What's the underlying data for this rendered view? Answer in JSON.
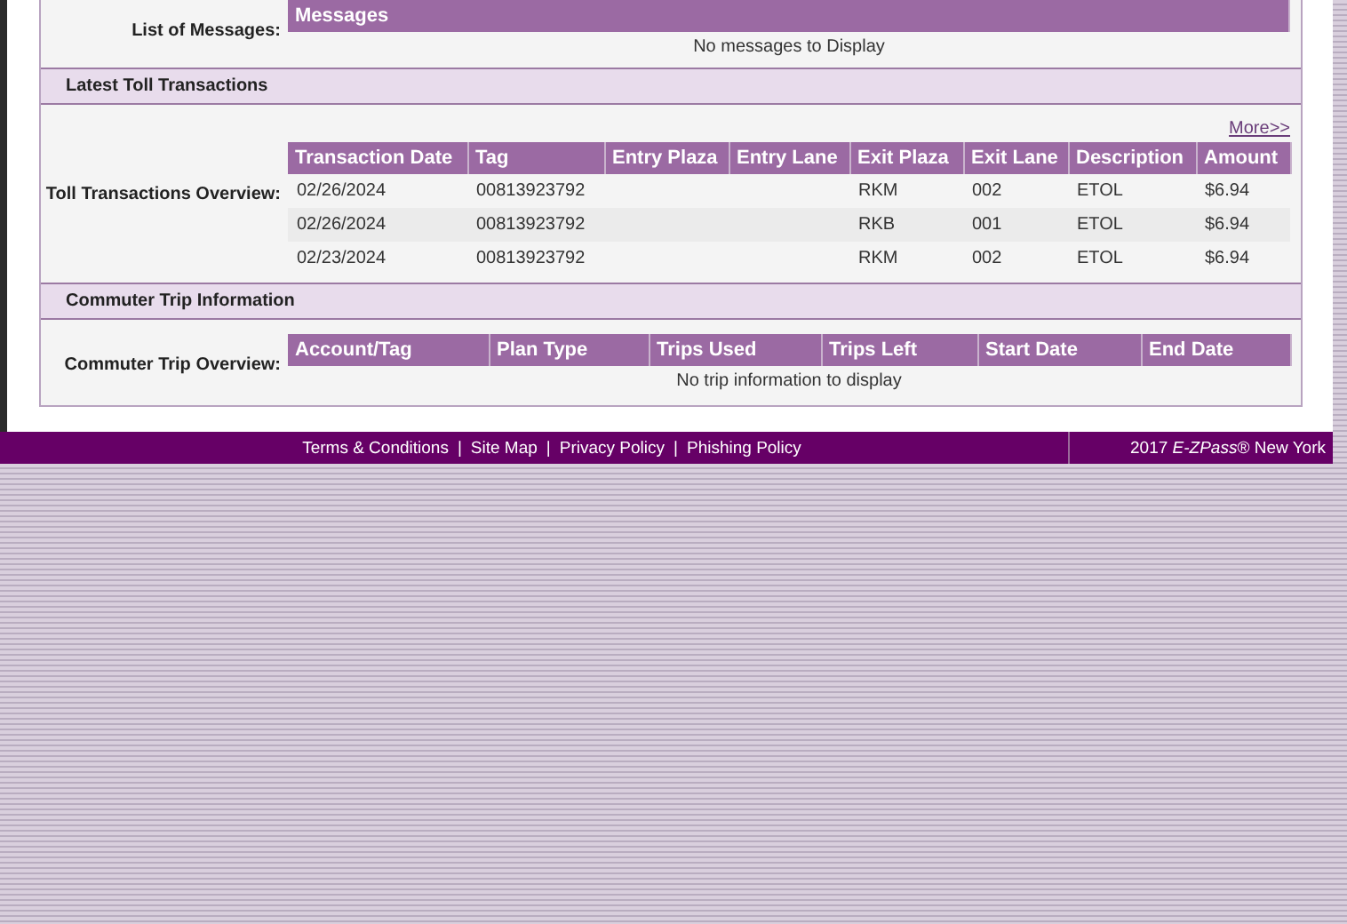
{
  "messages": {
    "label": "List of Messages:",
    "columns": [
      "Messages"
    ],
    "empty_text": "No messages to Display"
  },
  "toll_section": {
    "title": "Latest Toll Transactions",
    "label": "Toll Transactions Overview:",
    "more_link": "More>>",
    "columns": [
      "Transaction Date",
      "Tag",
      "Entry Plaza",
      "Entry Lane",
      "Exit Plaza",
      "Exit Lane",
      "Description",
      "Amount"
    ],
    "rows": [
      [
        "02/26/2024",
        "00813923792",
        "",
        "",
        "RKM",
        "002",
        "ETOL",
        "$6.94"
      ],
      [
        "02/26/2024",
        "00813923792",
        "",
        "",
        "RKB",
        "001",
        "ETOL",
        "$6.94"
      ],
      [
        "02/23/2024",
        "00813923792",
        "",
        "",
        "RKM",
        "002",
        "ETOL",
        "$6.94"
      ]
    ]
  },
  "commuter_section": {
    "title": "Commuter Trip Information",
    "label": "Commuter Trip Overview:",
    "columns": [
      "Account/Tag",
      "Plan Type",
      "Trips Used",
      "Trips Left",
      "Start Date",
      "End Date"
    ],
    "empty_text": "No trip information to display"
  },
  "footer": {
    "links": [
      "Terms & Conditions",
      "Site Map",
      "Privacy Policy",
      "Phishing Policy"
    ],
    "separator": "|",
    "copyright": "2017 *E-ZPass*® New York"
  }
}
